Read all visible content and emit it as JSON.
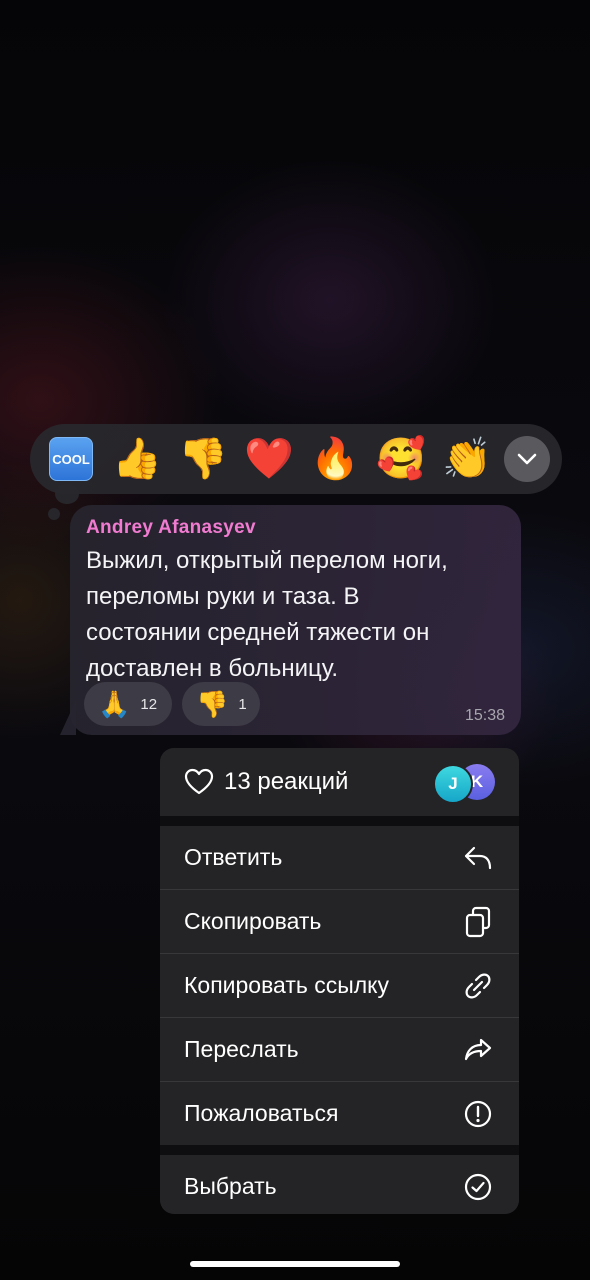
{
  "reaction_picker": {
    "items": [
      {
        "icon": "cool-emoji",
        "text": "COOL"
      },
      {
        "icon": "thumbs-up-emoji",
        "glyph": "👍"
      },
      {
        "icon": "thumbs-down-emoji",
        "glyph": "👎"
      },
      {
        "icon": "red-heart-emoji",
        "glyph": "❤️"
      },
      {
        "icon": "fire-emoji",
        "glyph": "🔥"
      },
      {
        "icon": "smiling-face-with-hearts-emoji",
        "glyph": "🥰"
      },
      {
        "icon": "clapping-hands-emoji",
        "glyph": "👏"
      }
    ],
    "expand_icon": "chevron-down-icon"
  },
  "message": {
    "author": "Andrey Afanasyev",
    "text_lines": [
      "Выжил, открытый перелом ноги,",
      "переломы руки и таза. В",
      "состоянии средней тяжести он",
      "доставлен в больницу."
    ],
    "reactions": [
      {
        "glyph": "🙏",
        "count": "12"
      },
      {
        "glyph": "👎",
        "count": "1"
      }
    ],
    "time": "15:38"
  },
  "context_menu": {
    "reactions_summary": "13 реакций",
    "avatars": [
      "J",
      "K"
    ],
    "items": [
      {
        "label": "Ответить",
        "icon": "reply-icon"
      },
      {
        "label": "Скопировать",
        "icon": "copy-icon"
      },
      {
        "label": "Копировать ссылку",
        "icon": "link-icon"
      },
      {
        "label": "Переслать",
        "icon": "forward-icon"
      },
      {
        "label": "Пожаловаться",
        "icon": "report-icon"
      }
    ],
    "select_item": {
      "label": "Выбрать",
      "icon": "checkmark-circle-icon"
    }
  }
}
